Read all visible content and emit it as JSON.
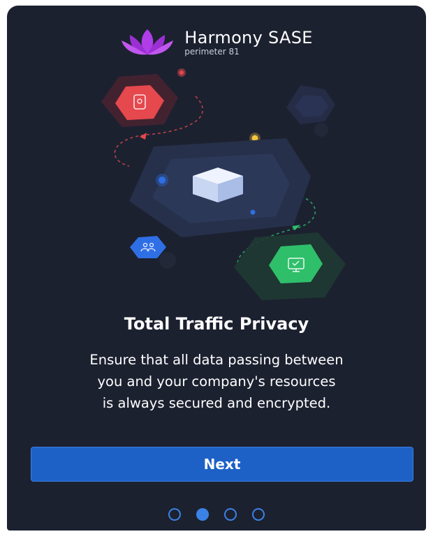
{
  "brand": {
    "name": "Harmony SASE",
    "subtitle": "perimeter 81",
    "logo_icon": "lotus-logo-icon",
    "logo_color": "#b03ee8"
  },
  "illustration": {
    "icons": [
      "shield-icon",
      "cube-icon",
      "users-icon",
      "monitor-icon"
    ],
    "colors": {
      "red": "#e5484d",
      "green": "#2fbf6a",
      "blue": "#2f6fe6",
      "yellow": "#f5c542"
    }
  },
  "onboarding": {
    "title": "Total Traffic Privacy",
    "description": [
      "Ensure that all data passing between",
      "you and your company's resources",
      "is always secured and encrypted."
    ],
    "next_label": "Next"
  },
  "pagination": {
    "total": 4,
    "current": 2
  },
  "colors": {
    "background": "#1c2130",
    "accent": "#1d61c7",
    "dot": "#3b82e6"
  }
}
